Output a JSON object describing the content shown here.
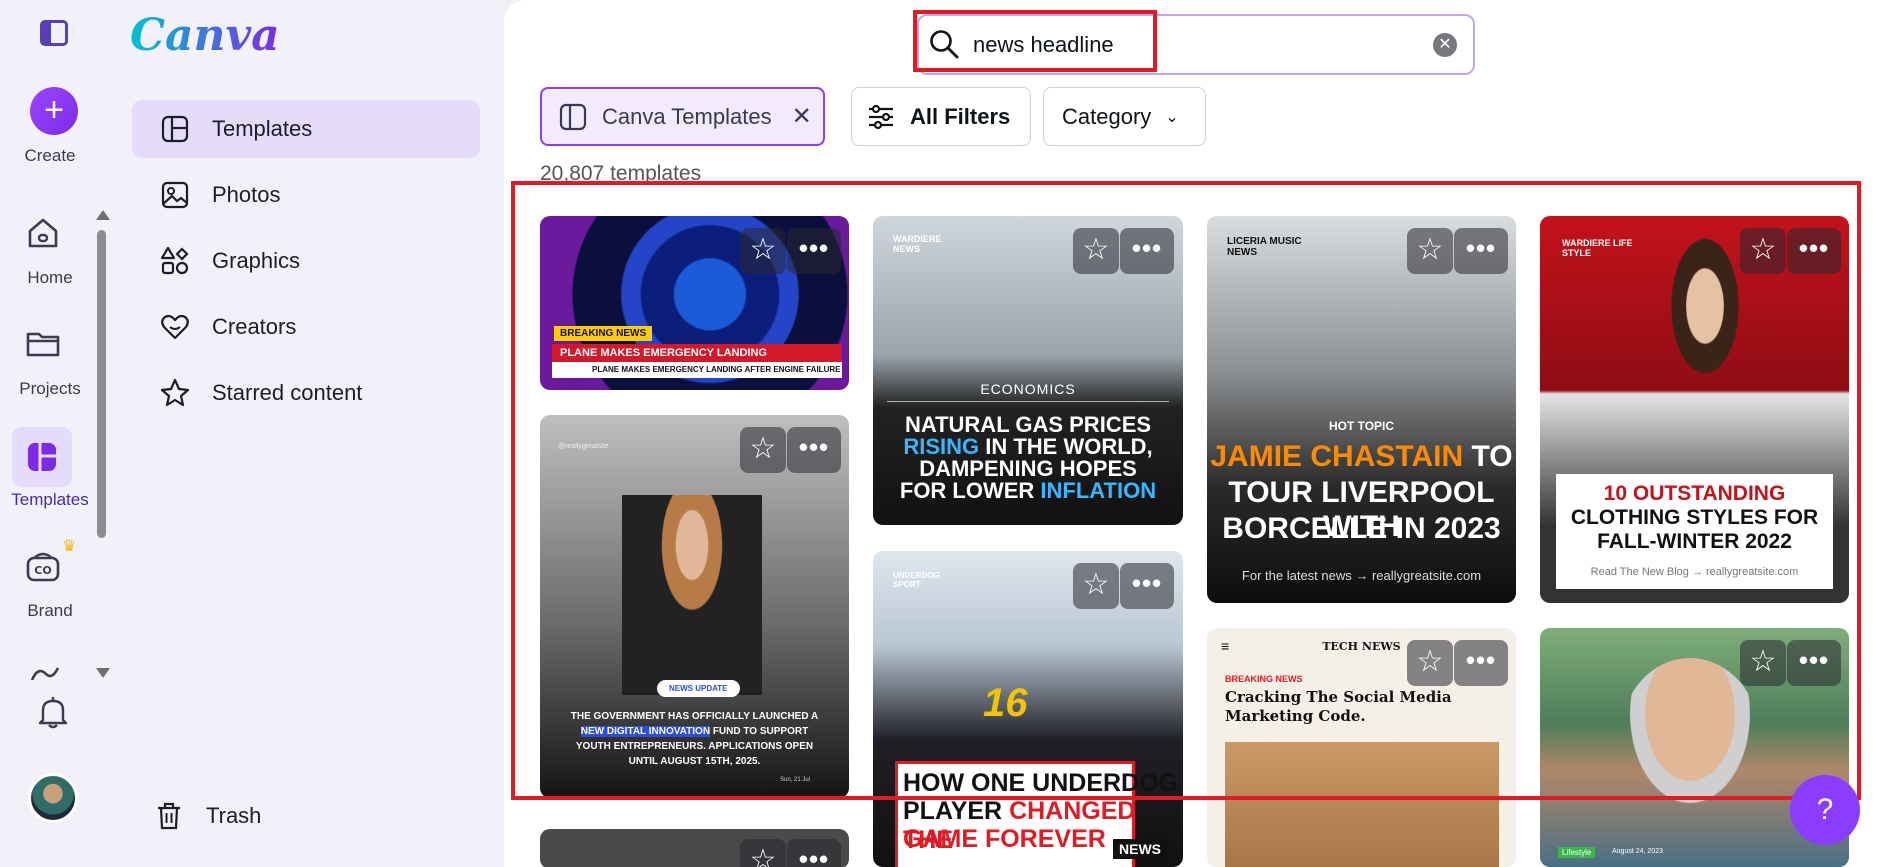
{
  "app": {
    "logo": "Canva"
  },
  "rail": {
    "create": "Create",
    "home": "Home",
    "projects": "Projects",
    "templates": "Templates",
    "brand": "Brand"
  },
  "nav": {
    "items": [
      {
        "label": "Templates",
        "icon": "templates-icon"
      },
      {
        "label": "Photos",
        "icon": "photos-icon"
      },
      {
        "label": "Graphics",
        "icon": "graphics-icon"
      },
      {
        "label": "Creators",
        "icon": "creators-icon"
      },
      {
        "label": "Starred content",
        "icon": "star-icon"
      }
    ],
    "trash": "Trash"
  },
  "search": {
    "value": "news headline"
  },
  "filters": {
    "canva_templates": "Canva Templates",
    "all_filters": "All Filters",
    "category": "Category"
  },
  "results": {
    "count": "20,807 templates"
  },
  "cards": {
    "c1": {
      "badge": "BREAKING NEWS",
      "headline": "PLANE MAKES EMERGENCY LANDING",
      "sub": "PLANE MAKES EMERGENCY LANDING AFTER ENGINE FAILURE"
    },
    "c2": {
      "brand": "WARDIERE NEWS",
      "section": "ECONOMICS",
      "line1": "NATURAL GAS PRICES",
      "line2a": "RISING",
      "line2b": " IN THE WORLD,",
      "line3": "DAMPENING HOPES",
      "line4a": "FOR LOWER ",
      "line4b": "INFLATION"
    },
    "c3": {
      "brand": "LICERIA MUSIC NEWS",
      "topic": "HOT TOPIC",
      "name": "JAMIE CHASTAIN",
      "rest1": " TO",
      "rest2": "TOUR LIVERPOOL WITH",
      "rest3": "BORCELLE IN 2023",
      "footer": "For the latest news  →  reallygreatsite.com"
    },
    "c4": {
      "brand": "WARDIERE LIFE STYLE",
      "title1": "10 OUTSTANDING",
      "title2": "CLOTHING STYLES FOR",
      "title3": "FALL-WINTER 2022",
      "footer": "Read The New Blog   →   reallygreatsite.com"
    },
    "c5": {
      "handle": "@reallygreatsite",
      "pill": "NEWS UPDATE",
      "t1": "THE GOVERNMENT HAS OFFICIALLY LAUNCHED A",
      "t2a": "NEW DIGITAL INNOVATION",
      "t2b": " FUND TO SUPPORT",
      "t3": "YOUTH ENTREPRENEURS. APPLICATIONS OPEN",
      "t4": "UNTIL AUGUST 15TH, 2025.",
      "date": "Sun, 21 Jul"
    },
    "c6": {
      "brand": "UNDERDOG SPORT",
      "number": "16",
      "h1": "HOW ONE UNDERDOG",
      "h2a": "PLAYER ",
      "h2b": "CHANGED THE",
      "h3": "GAME FOREVER",
      "tag": "NEWS"
    },
    "c7": {
      "masthead": "TECH NEWS",
      "badge": "BREAKING NEWS",
      "title1": "Cracking The Social Media",
      "title2": "Marketing Code."
    },
    "c8": {
      "tag": "Lifestyle",
      "date": "August 24, 2023"
    }
  },
  "help": "?",
  "colors": {
    "accent": "#8b3dff",
    "highlight": "#e01b24"
  }
}
